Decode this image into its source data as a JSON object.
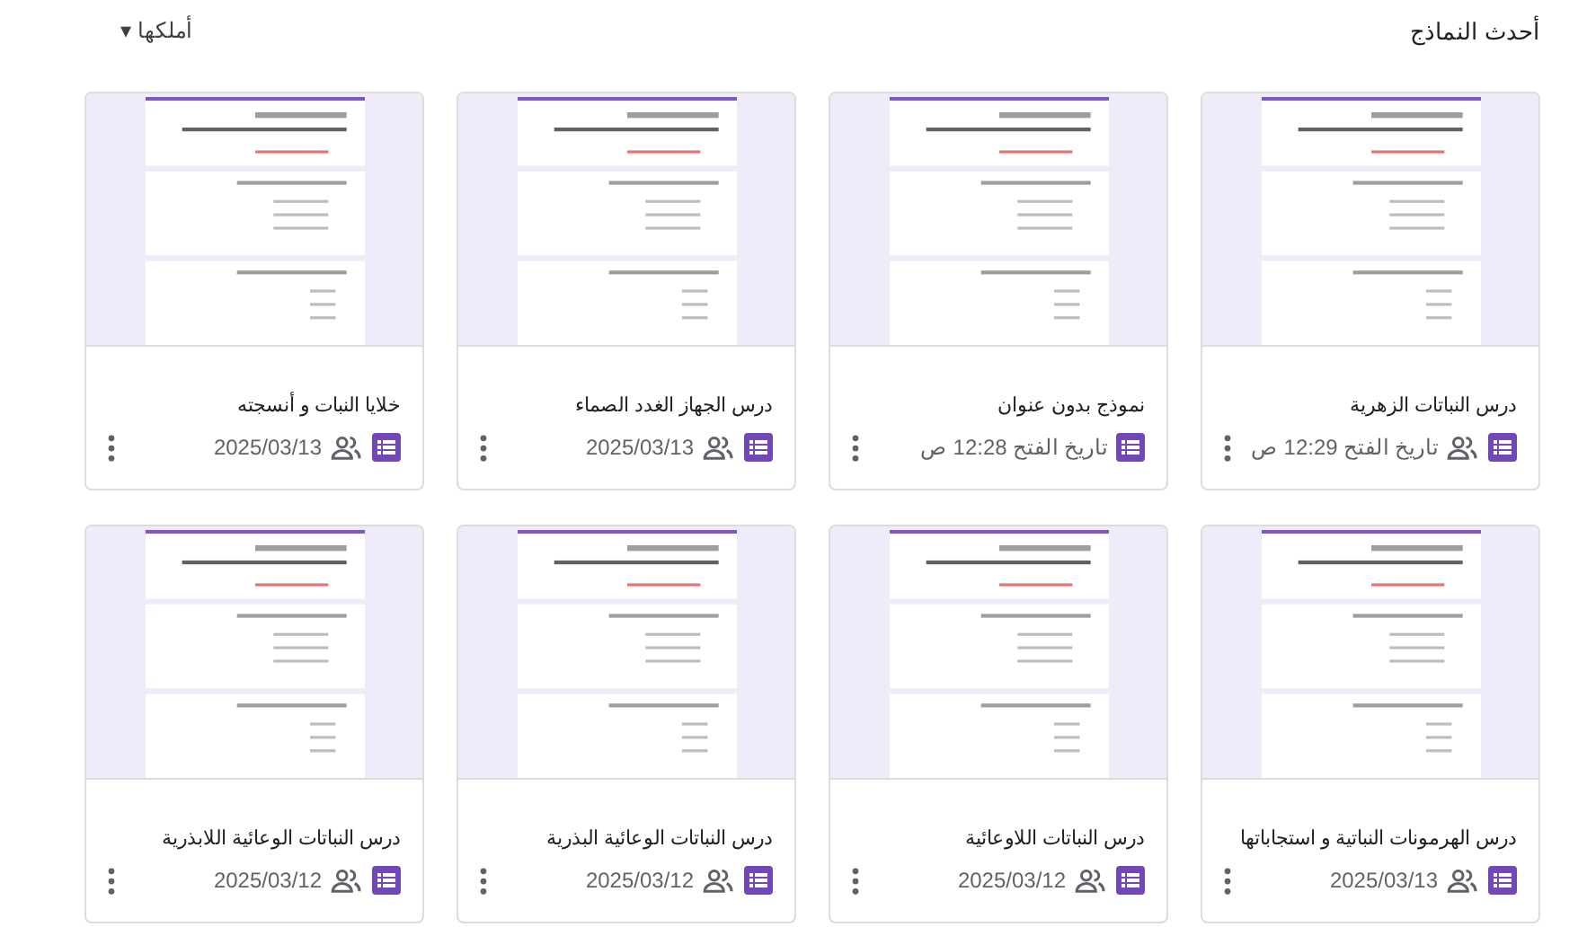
{
  "header": {
    "title": "أحدث النماذج",
    "owner_filter": "أملكها",
    "dropdown_glyph": "▾"
  },
  "forms": [
    {
      "title": "درس النباتات الزهرية",
      "meta": "تاريخ الفتح 12:29 ص",
      "shared": true
    },
    {
      "title": "نموذج بدون عنوان",
      "meta": "تاريخ الفتح 12:28 ص",
      "shared": false
    },
    {
      "title": "درس الجهاز الغدد الصماء",
      "meta": "2025/03/13",
      "shared": true
    },
    {
      "title": "خلايا النبات و أنسجته",
      "meta": "2025/03/13",
      "shared": true
    },
    {
      "title": "درس الهرمونات النباتية و استجاباتها",
      "meta": "2025/03/13",
      "shared": true
    },
    {
      "title": "درس النباتات اللاوعائية",
      "meta": "2025/03/12",
      "shared": true
    },
    {
      "title": "درس النباتات الوعائية البذرية",
      "meta": "2025/03/12",
      "shared": true
    },
    {
      "title": "درس النباتات الوعائية اللابذرية",
      "meta": "2025/03/12",
      "shared": true
    }
  ]
}
